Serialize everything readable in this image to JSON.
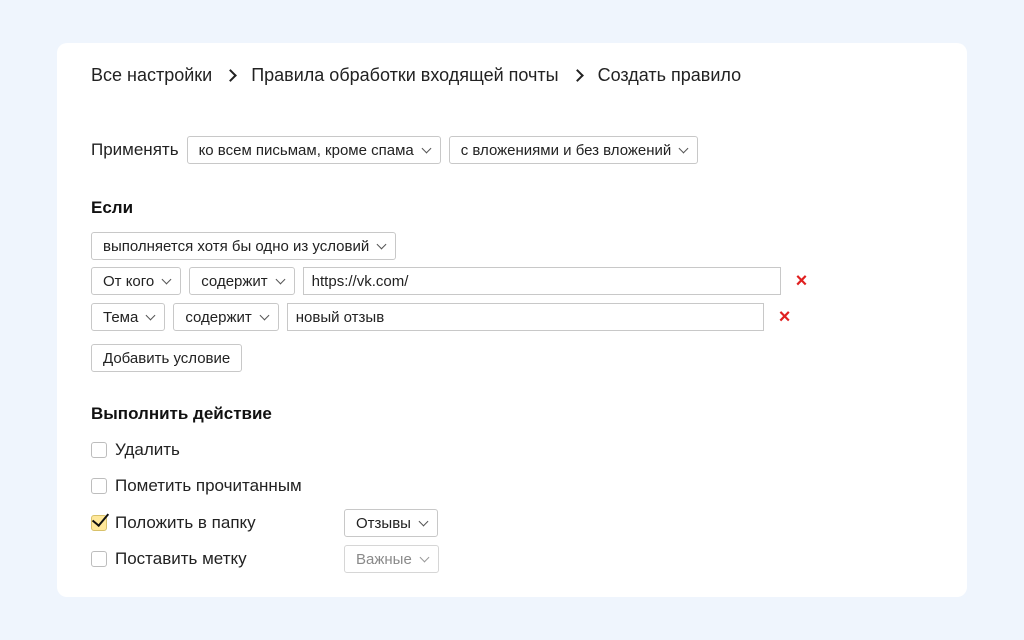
{
  "breadcrumb": {
    "items": [
      "Все настройки",
      "Правила обработки входящей почты",
      "Создать правило"
    ]
  },
  "apply": {
    "label": "Применять",
    "scope_value": "ко всем письмам, кроме спама",
    "attachments_value": "с вложениями и без вложений"
  },
  "if_section": {
    "title": "Если",
    "match_mode": "выполняется хотя бы одно из условий",
    "conditions": [
      {
        "field": "От кого",
        "operator": "содержит",
        "value": "https://vk.com/"
      },
      {
        "field": "Тема",
        "operator": "содержит",
        "value": "новый отзыв"
      }
    ],
    "add_condition_label": "Добавить условие",
    "remove_icon": "×"
  },
  "actions_section": {
    "title": "Выполнить действие",
    "actions": [
      {
        "label": "Удалить",
        "checked": false
      },
      {
        "label": "Пометить прочитанным",
        "checked": false
      },
      {
        "label": "Положить в папку",
        "checked": true,
        "select_value": "Отзывы"
      },
      {
        "label": "Поставить метку",
        "checked": false,
        "select_value": "Важные",
        "select_disabled": true
      }
    ]
  },
  "colors": {
    "page_background": "#eff5fd",
    "card_background": "#ffffff",
    "remove_icon": "#e02020",
    "checkbox_checked": "#ffe89a"
  }
}
